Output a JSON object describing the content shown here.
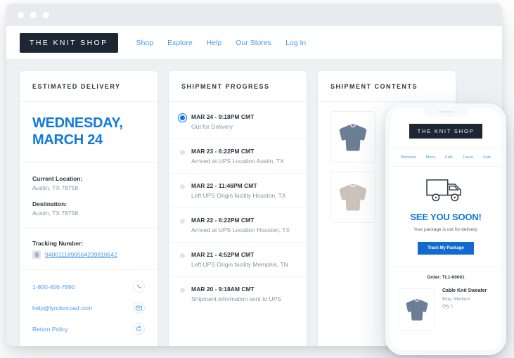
{
  "browser": {
    "dots": [
      "close-dot",
      "minimize-dot",
      "maximize-dot"
    ]
  },
  "header": {
    "logo": "THE KNIT SHOP",
    "nav": [
      {
        "label": "Shop"
      },
      {
        "label": "Explore"
      },
      {
        "label": "Help"
      },
      {
        "label": "Our Stores"
      },
      {
        "label": "Log In"
      }
    ]
  },
  "delivery_card": {
    "title": "ESTIMATED DELIVERY",
    "eta_line1": "WEDNESDAY,",
    "eta_line2": "MARCH 24",
    "current_location_label": "Current Location:",
    "current_location_value": "Austin, TX 78758",
    "destination_label": "Destination:",
    "destination_value": "Austin, TX 78758",
    "tracking_label": "Tracking Number:",
    "tracking_number": "9400111899564239810642",
    "contacts": [
      {
        "label": "1-800-456-7890",
        "icon": "phone-icon"
      },
      {
        "label": "help@lyndonroad.com",
        "icon": "envelope-icon"
      },
      {
        "label": "Return Policy",
        "icon": "return-arrow-icon"
      }
    ]
  },
  "progress_card": {
    "title": "SHIPMENT PROGRESS",
    "events": [
      {
        "date": "MAR 24 - 9:18PM CMT",
        "desc": "Out for Delivery",
        "active": true
      },
      {
        "date": "MAR 23 - 6:22PM CMT",
        "desc": "Arrived at UPS Location Austin, TX",
        "active": false
      },
      {
        "date": "MAR 22 - 11:46PM CMT",
        "desc": "Left UPS Origin facility Houston, TX",
        "active": false
      },
      {
        "date": "MAR 22 - 6:22PM CMT",
        "desc": "Arrived at UPS Location Houston, TX",
        "active": false
      },
      {
        "date": "MAR 21 - 4:52PM CMT",
        "desc": "Left UPS Origin facility Memphis, TN",
        "active": false
      },
      {
        "date": "MAR 20 - 9:18AM CMT",
        "desc": "Shipment information sent to UPS",
        "active": false
      }
    ]
  },
  "contents_card": {
    "title": "SHIPMENT CONTENTS",
    "items": [
      {
        "name": "blue-sweater-thumbnail",
        "color": "#6d7f96"
      },
      {
        "name": "beige-sweater-thumbnail",
        "color": "#cdc3b8"
      }
    ]
  },
  "phone": {
    "logo": "THE KNIT SHOP",
    "nav": [
      {
        "label": "Womens"
      },
      {
        "label": "Mens"
      },
      {
        "label": "Kids"
      },
      {
        "label": "Travel"
      },
      {
        "label": "Sale"
      }
    ],
    "hero_icon": "delivery-truck-icon",
    "headline": "SEE YOU SOON!",
    "subline": "Your package is out for delivery.",
    "button": "Track My Package",
    "order_label": "Order: TL1-00001",
    "item": {
      "name": "Cable Knit Sweater",
      "variant": "Blue, Medium",
      "qty": "Qty 1"
    }
  },
  "colors": {
    "accent_blue": "#1178e0",
    "link_blue": "#4a9cf0",
    "button_blue": "#1269cf",
    "dark": "#1d2733",
    "page_bg": "#eef1f4"
  }
}
